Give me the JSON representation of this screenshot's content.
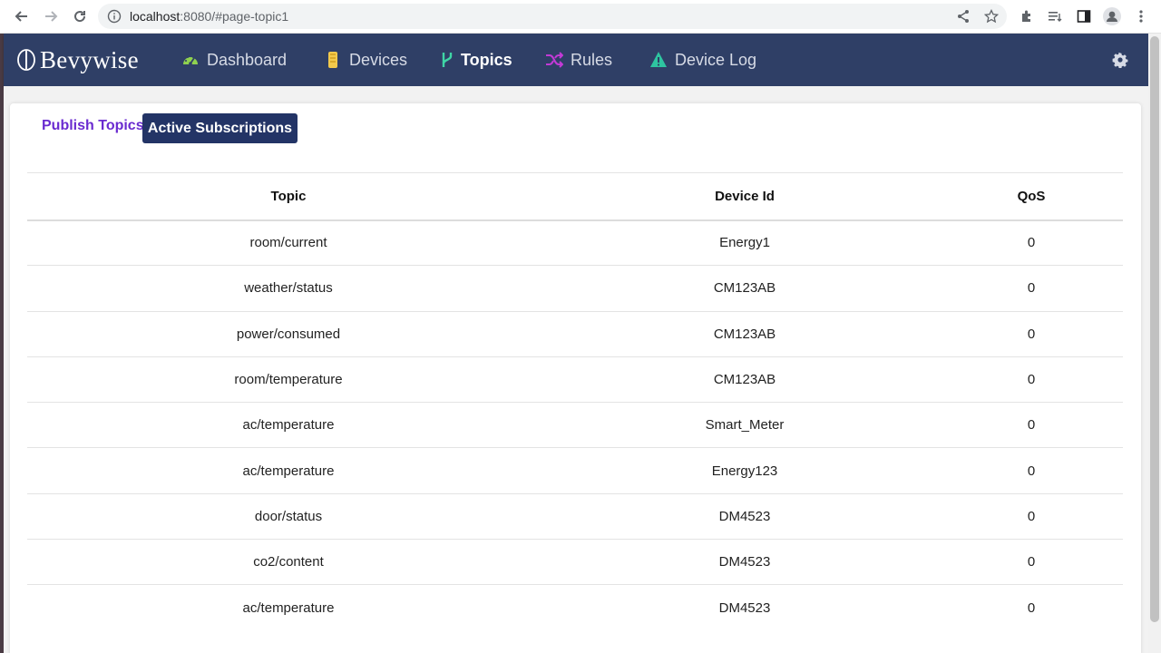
{
  "browser": {
    "url_host": "localhost",
    "url_path": ":8080/#page-topic1"
  },
  "app": {
    "brand": "Bevywise",
    "nav": [
      {
        "label": "Dashboard",
        "icon": "dashboard-gauge-icon",
        "color": "#8fd14f"
      },
      {
        "label": "Devices",
        "icon": "devices-icon",
        "color": "#f2c94c"
      },
      {
        "label": "Topics",
        "icon": "topics-branch-icon",
        "color": "#3fd6a6",
        "active": true
      },
      {
        "label": "Rules",
        "icon": "rules-shuffle-icon",
        "color": "#c23ad6"
      },
      {
        "label": "Device Log",
        "icon": "device-log-warning-icon",
        "color": "#2ec4a0"
      }
    ],
    "settings_icon": "gear-icon",
    "header_color": "#2f3f66"
  },
  "tabs": {
    "publish": "Publish Topics",
    "active_subscriptions": "Active Subscriptions"
  },
  "table": {
    "headers": [
      "Topic",
      "Device Id",
      "QoS"
    ],
    "rows": [
      [
        "room/current",
        "Energy1",
        "0"
      ],
      [
        "weather/status",
        "CM123AB",
        "0"
      ],
      [
        "power/consumed",
        "CM123AB",
        "0"
      ],
      [
        "room/temperature",
        "CM123AB",
        "0"
      ],
      [
        "ac/temperature",
        "Smart_Meter",
        "0"
      ],
      [
        "ac/temperature",
        "Energy123",
        "0"
      ],
      [
        "door/status",
        "DM4523",
        "0"
      ],
      [
        "co2/content",
        "DM4523",
        "0"
      ],
      [
        "ac/temperature",
        "DM4523",
        "0"
      ]
    ]
  }
}
